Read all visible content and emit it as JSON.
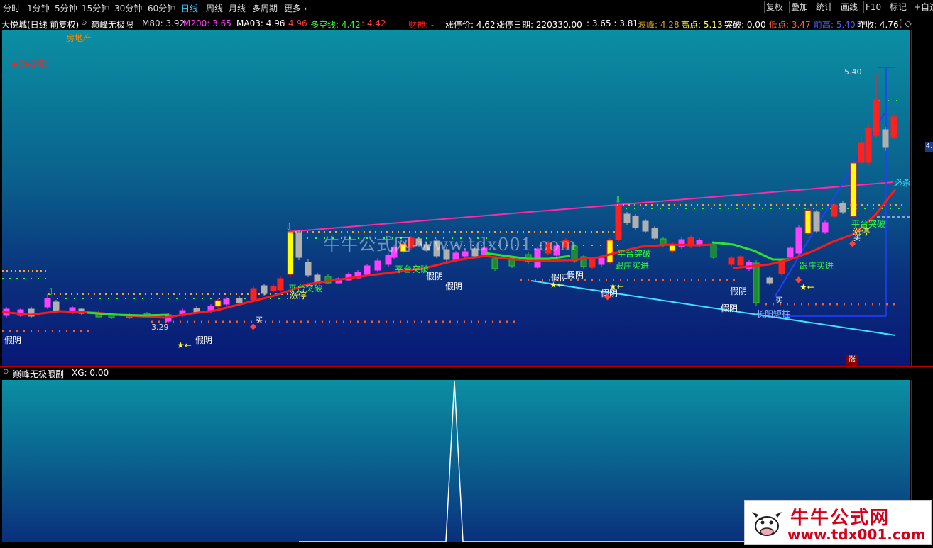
{
  "toolbar": {
    "periods": [
      "分时",
      "1分钟",
      "5分钟",
      "15分钟",
      "30分钟",
      "60分钟",
      "日线",
      "周线",
      "月线",
      "多周期",
      "更多 ›"
    ],
    "active_period": "日线",
    "right_buttons": [
      "复权",
      "叠加",
      "统计",
      "画线",
      "F10",
      "标记",
      "+自选"
    ]
  },
  "infobar": {
    "stock": "大悦城(日线 前复权)",
    "indicator": "巅峰无极限",
    "m80": "M80: 3.92",
    "m200": "M200: 3.65",
    "ma03": "MA03: 4.96",
    "ma03b": ": 4.96",
    "duokong": "多空线: 4.42",
    "duokong_b": ": 4.42",
    "caishen": "财神: -",
    "zt_price": "涨停价: 4.62",
    "zt_date": "涨停日期: 220330.00",
    "vals": ": 3.65 : 3.81",
    "bofeng": "波峰: 4.28",
    "gaodian": "高点: 5.13",
    "tupo": "突破: 0.00",
    "didian": "低点: 3.47",
    "qiangao": "前高: 5.40",
    "zuoshou": "昨收: 4.76",
    "tail": "[ ◇"
  },
  "chart_labels": {
    "sector": "房地产",
    "theme": "主题投资:",
    "price_high": "5.40",
    "price_low": "3.29",
    "bisha": "必杀攻击",
    "pingtai1": "平台突破",
    "pingtai2": "平台突破",
    "pingtai3": "平台突破",
    "pingtai4": "平台突破",
    "zhangting1": "涨停",
    "zhangting2": "涨停",
    "genzhuang1": "跟庄买进",
    "genzhuang2": "跟庄买进",
    "jiayin": "假阴",
    "mai": "买",
    "changyang": "长阳短柱",
    "zhang_badge": "涨",
    "axis_badge": "4."
  },
  "watermark": "牛牛公式网-www.tdx001.com",
  "subpanel": {
    "name": "巅峰无极限副",
    "xg": "XG: 0.00"
  },
  "logo": {
    "title": "牛牛公式网",
    "url": "www.tdx001.com"
  },
  "colors": {
    "up": "#ff2020",
    "down": "#b0b0b0",
    "magenta": "#ff40ff",
    "green": "#30ff30",
    "yellow": "#ffff00",
    "cyan": "#40e0ff",
    "pink_line": "#ff2aa8"
  }
}
